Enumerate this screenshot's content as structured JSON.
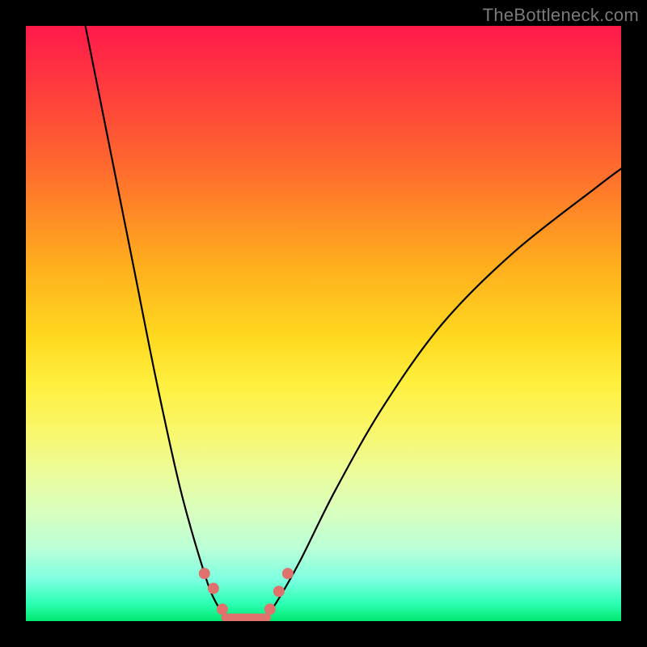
{
  "watermark": "TheBottleneck.com",
  "chart_data": {
    "type": "line",
    "title": "",
    "xlabel": "",
    "ylabel": "",
    "xlim": [
      0,
      100
    ],
    "ylim": [
      0,
      100
    ],
    "series": [
      {
        "name": "left-branch",
        "x": [
          10,
          14,
          18,
          22,
          26,
          30,
          32,
          34
        ],
        "y": [
          100,
          80,
          60,
          40,
          22,
          8,
          3,
          0.5
        ]
      },
      {
        "name": "right-branch",
        "x": [
          40,
          42,
          46,
          52,
          60,
          70,
          82,
          96,
          100
        ],
        "y": [
          0.5,
          3,
          10,
          22,
          36,
          50,
          62,
          73,
          76
        ]
      }
    ],
    "markers": [
      {
        "name": "left-upper-dot",
        "x": 30,
        "y": 8
      },
      {
        "name": "left-lower-dot",
        "x": 31.5,
        "y": 5.5
      },
      {
        "name": "left-knee-dot",
        "x": 33,
        "y": 2
      },
      {
        "name": "right-knee-dot",
        "x": 41,
        "y": 2
      },
      {
        "name": "right-lower-dot",
        "x": 42.5,
        "y": 5
      },
      {
        "name": "right-upper-dot",
        "x": 44,
        "y": 8
      }
    ],
    "flat_segment": {
      "x0": 33.5,
      "x1": 40.5,
      "y": 0.6
    },
    "background_gradient": {
      "top": "#ff1a4b",
      "mid": "#ffef3e",
      "bottom": "#00e96f"
    }
  }
}
